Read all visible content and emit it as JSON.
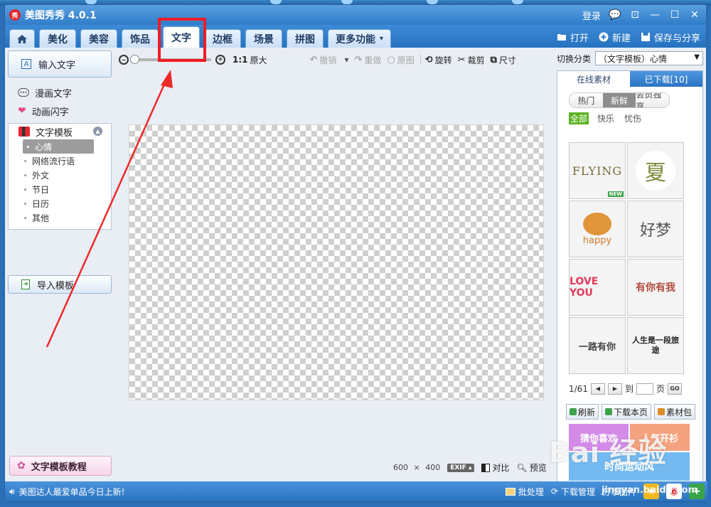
{
  "window": {
    "title": "美图秀秀 4.0.1",
    "logo_text": "秀",
    "login": "登录",
    "controls": [
      "💬",
      "⊡",
      "—",
      "☐",
      "✕"
    ]
  },
  "tabs": [
    {
      "label": "",
      "icon": "home-icon",
      "active": false
    },
    {
      "label": "美化",
      "active": false
    },
    {
      "label": "美容",
      "active": false
    },
    {
      "label": "饰品",
      "active": false
    },
    {
      "label": "文字",
      "active": true
    },
    {
      "label": "边框",
      "active": false
    },
    {
      "label": "场景",
      "active": false
    },
    {
      "label": "拼图",
      "active": false
    },
    {
      "label": "更多功能",
      "active": false
    }
  ],
  "tab_actions": {
    "open": "打开",
    "new": "新建",
    "save_share": "保存与分享"
  },
  "left": {
    "input_text": "输入文字",
    "comic_text": "漫画文字",
    "anim_text": "动画闪字",
    "template_header": "文字模板",
    "template_items": [
      "心情",
      "网络流行语",
      "外文",
      "节日",
      "日历",
      "其他"
    ],
    "import_template": "导入模板",
    "tutorial": "文字模板教程"
  },
  "toolbar": {
    "ratio": "1:1",
    "original_size": "原大",
    "undo": "撤销",
    "redo": "重做",
    "original": "原图",
    "rotate": "旋转",
    "crop": "裁剪",
    "size": "尺寸"
  },
  "canvas_info": {
    "width": "600",
    "times": "×",
    "height": "400",
    "exif": "EXIF",
    "compare": "对比",
    "preview": "预览"
  },
  "right": {
    "category_label": "切换分类",
    "category_value": "（文字模板）心情",
    "tab_online": "在线素材",
    "tab_downloaded": "已下载[10]",
    "filters": [
      "热门",
      "新鲜",
      "会员独享"
    ],
    "moods": [
      "全部",
      "快乐",
      "忧伤"
    ],
    "thumbs": [
      "FLYING",
      "夏",
      "happy",
      "好梦",
      "LOVE YOU",
      "有你有我",
      "一路有你",
      "人生是一段旅途"
    ],
    "new_badge": "NEW",
    "page_current": "1/61",
    "goto": "到",
    "page_unit": "页",
    "go": "GO",
    "refresh": "刷新",
    "download_page": "下载本页",
    "material_pack": "素材包",
    "promo_guess": "猜你喜欢",
    "promo_popular": "人气开衫",
    "promo_sport": "时尚运动风"
  },
  "status": {
    "marquee": "美图达人最爱单品今日上新!",
    "batch": "批处理",
    "download_mgr": "下载管理",
    "share_pic": "分享图片"
  },
  "watermark": {
    "brand": "Bai 经验",
    "site": "jingyan.baidu.com"
  }
}
